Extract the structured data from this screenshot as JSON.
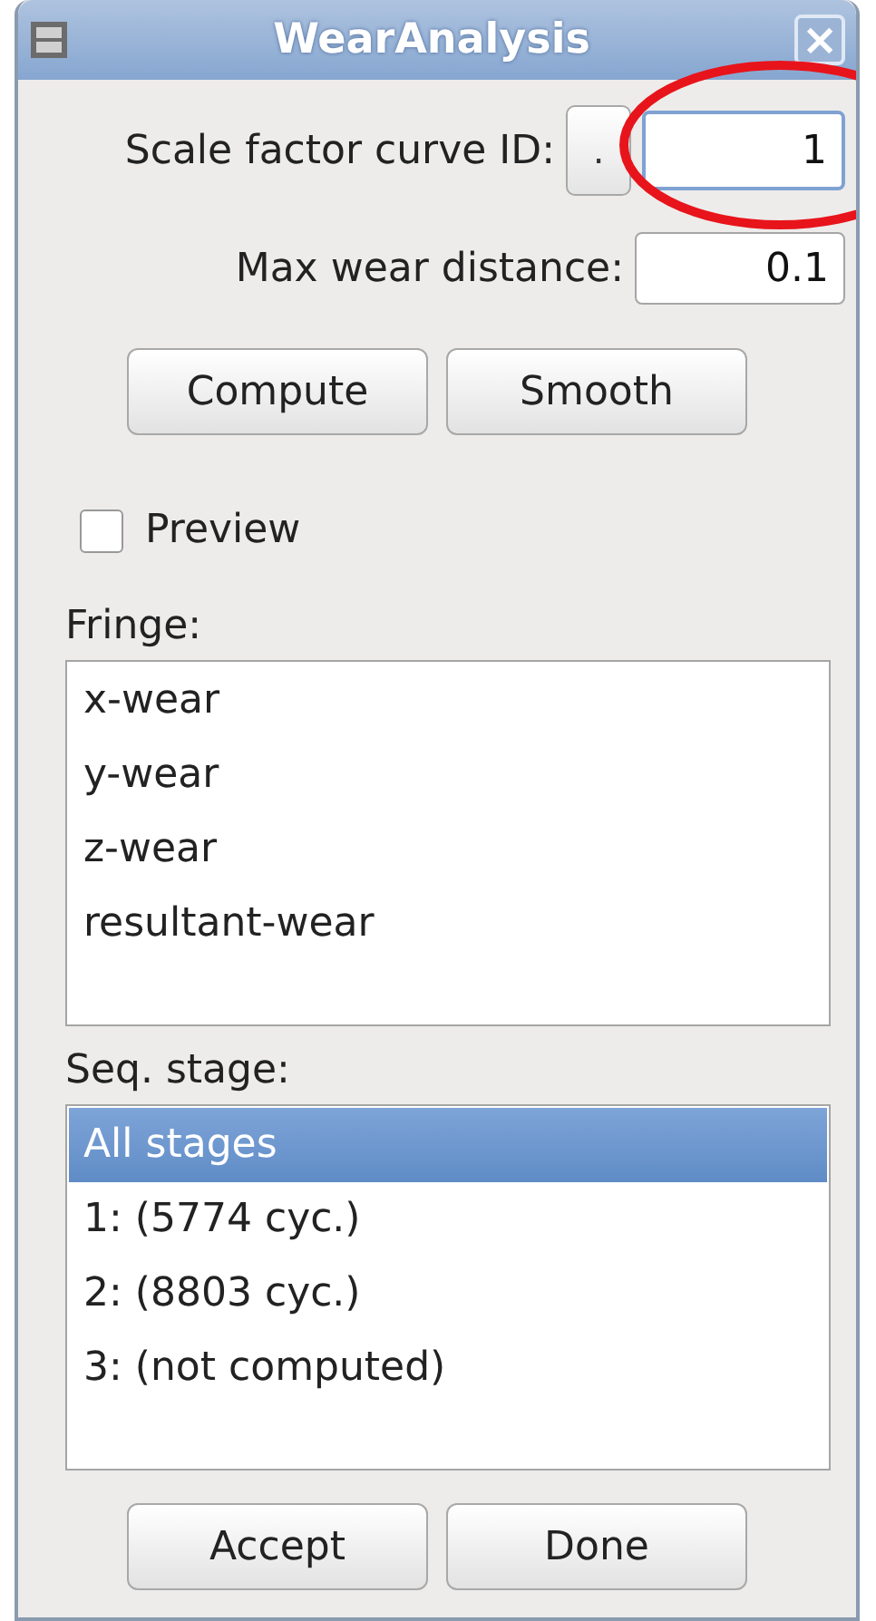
{
  "window": {
    "title": "WearAnalysis",
    "close": "×"
  },
  "scale_factor": {
    "label": "Scale factor curve ID:",
    "pick_button": ".",
    "value": "1",
    "focused": true
  },
  "max_wear": {
    "label": "Max wear distance:",
    "value": "0.1"
  },
  "actions": [
    "Compute",
    "Smooth"
  ],
  "preview": {
    "label": "Preview",
    "checked": false
  },
  "fringe": {
    "label": "Fringe:",
    "items": [
      {
        "label": "x-wear",
        "selected": false
      },
      {
        "label": "y-wear",
        "selected": false
      },
      {
        "label": "z-wear",
        "selected": false
      },
      {
        "label": "resultant-wear",
        "selected": false
      }
    ]
  },
  "seq_stage": {
    "label": "Seq. stage:",
    "items": [
      {
        "label": "All stages",
        "selected": true
      },
      {
        "label": "1: (5774 cyc.)",
        "selected": false
      },
      {
        "label": "2: (8803 cyc.)",
        "selected": false
      },
      {
        "label": "3: (not computed)",
        "selected": false
      }
    ]
  },
  "buttons": [
    "Accept",
    "Done"
  ],
  "highlight": {
    "kind": "ellipse"
  }
}
